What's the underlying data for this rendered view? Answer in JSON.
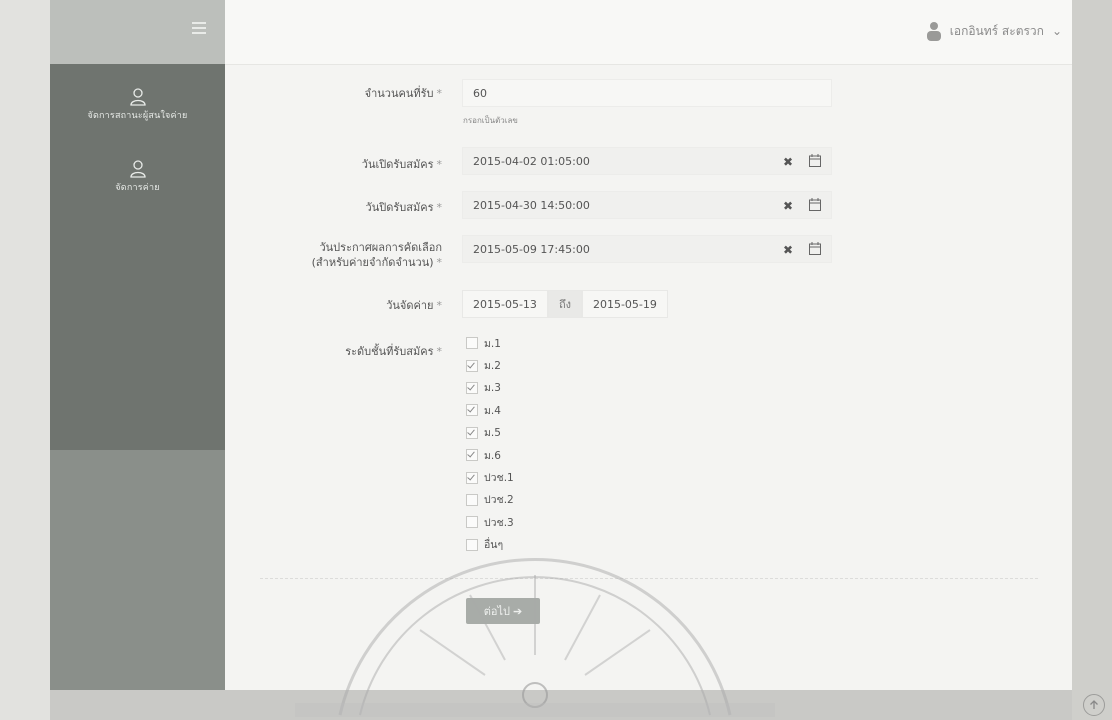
{
  "sidebar": {
    "items": [
      {
        "label": "จัดการสถานะผู้สนใจค่าย",
        "icon": "user-icon"
      },
      {
        "label": "จัดการค่าย",
        "icon": "user-icon"
      }
    ]
  },
  "header": {
    "user_name": "เอกอินทร์ สะตรวก",
    "user_chevron": "⌄"
  },
  "form": {
    "capacity": {
      "label": "จำนวนคนที่รับ",
      "required": "*",
      "value": "60",
      "hint": "กรอกเป็นตัวเลข"
    },
    "open_date": {
      "label": "วันเปิดรับสมัคร",
      "required": "*",
      "value": "2015-04-02 01:05:00",
      "clear": "✖"
    },
    "close_date": {
      "label": "วันปิดรับสมัคร",
      "required": "*",
      "value": "2015-04-30 14:50:00",
      "clear": "✖"
    },
    "announce_date": {
      "label_line1": "วันประกาศผลการคัดเลือก",
      "label_line2": "(สำหรับค่ายจำกัดจำนวน)",
      "required": "*",
      "value": "2015-05-09 17:45:00",
      "clear": "✖"
    },
    "camp_date": {
      "label": "วันจัดค่าย",
      "required": "*",
      "start": "2015-05-13",
      "to": "ถึง",
      "end": "2015-05-19"
    },
    "levels": {
      "label": "ระดับชั้นที่รับสมัคร",
      "required": "*",
      "options": [
        {
          "label": "ม.1",
          "checked": false
        },
        {
          "label": "ม.2",
          "checked": true
        },
        {
          "label": "ม.3",
          "checked": true
        },
        {
          "label": "ม.4",
          "checked": true
        },
        {
          "label": "ม.5",
          "checked": true
        },
        {
          "label": "ม.6",
          "checked": true
        },
        {
          "label": "ปวช.1",
          "checked": true
        },
        {
          "label": "ปวช.2",
          "checked": false
        },
        {
          "label": "ปวช.3",
          "checked": false
        },
        {
          "label": "อื่นๆ",
          "checked": false
        }
      ]
    },
    "next_button": "ต่อไป ➔"
  },
  "colors": {
    "sidebar": "#6f746f",
    "button": "#a8aca8"
  }
}
